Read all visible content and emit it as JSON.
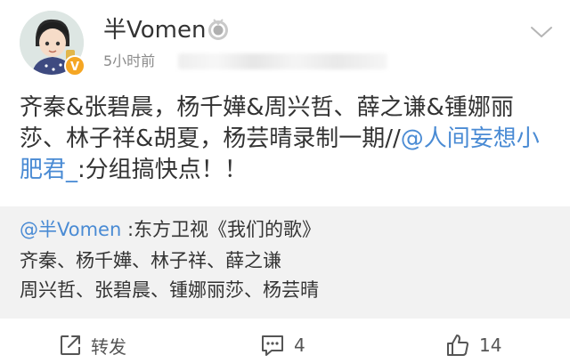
{
  "post": {
    "username": "半Vomen",
    "timestamp": "5小时前",
    "body_prefix": "齐秦&张碧晨，杨千嬅&周兴哲、薛之谦&锺娜丽莎、林子祥&胡夏，杨芸晴录制一期//",
    "body_mention": "@人间妄想小肥君_",
    "body_suffix": ":分组搞快点！！"
  },
  "repost": {
    "mention": "@半Vomen",
    "line1_text": " :东方卫视《我们的歌》",
    "line2": "齐秦、杨千嬅、林子祥、薛之谦",
    "line3": "周兴哲、张碧晨、锺娜丽莎、杨芸晴"
  },
  "actions": {
    "repost_label": "转发",
    "comment_count": "4",
    "like_count": "14"
  },
  "colors": {
    "link": "#4a8bd4",
    "text": "#333333",
    "muted": "#8b8b8b",
    "repost_bg": "#f2f2f2",
    "verify_badge": "#f5a623"
  },
  "icons": {
    "avatar": "cartoon-avatar",
    "verify": "verified-badge-icon",
    "vip": "medal-badge-icon",
    "more": "chevron-down-icon",
    "repost": "share-icon",
    "comment": "comment-icon",
    "like": "thumbs-up-icon"
  }
}
